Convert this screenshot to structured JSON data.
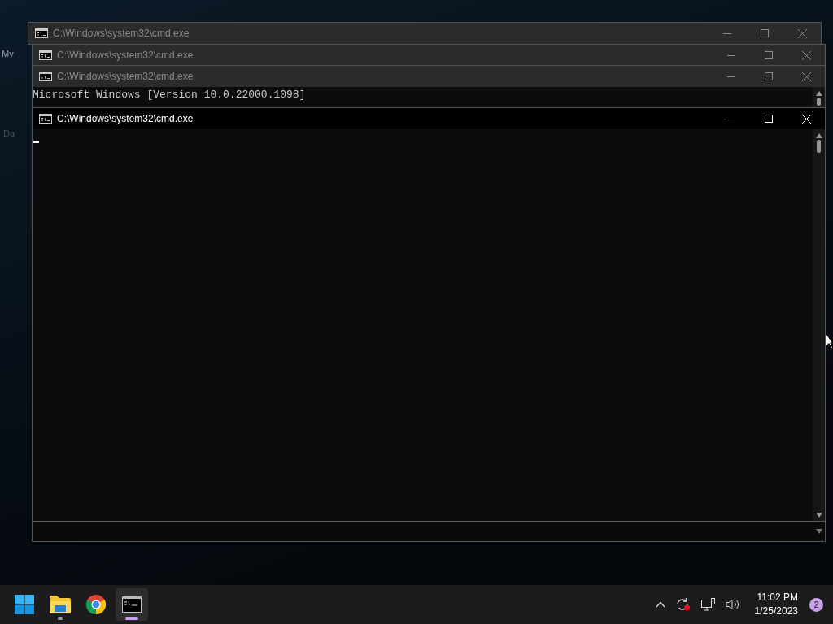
{
  "desktop": {
    "icon_labels": [
      "My",
      "Da"
    ]
  },
  "windows": [
    {
      "title": "C:\\Windows\\system32\\cmd.exe",
      "active": false
    },
    {
      "title": "C:\\Windows\\system32\\cmd.exe",
      "active": false
    },
    {
      "title": "C:\\Windows\\system32\\cmd.exe",
      "active": false,
      "lines": [
        "Microsoft Windows [Version 10.0.22000.1098]"
      ]
    },
    {
      "title": "C:\\Windows\\system32\\cmd.exe",
      "active": true
    }
  ],
  "taskbar": {
    "apps": [
      {
        "kind": "start",
        "running": false,
        "selected": false
      },
      {
        "kind": "folder",
        "running": true,
        "selected": false
      },
      {
        "kind": "browser",
        "running": false,
        "selected": false
      },
      {
        "kind": "terminal",
        "running": true,
        "selected": true
      }
    ],
    "clock": {
      "time": "11:02 PM",
      "date": "1/25/2023"
    },
    "notifications": "2"
  }
}
